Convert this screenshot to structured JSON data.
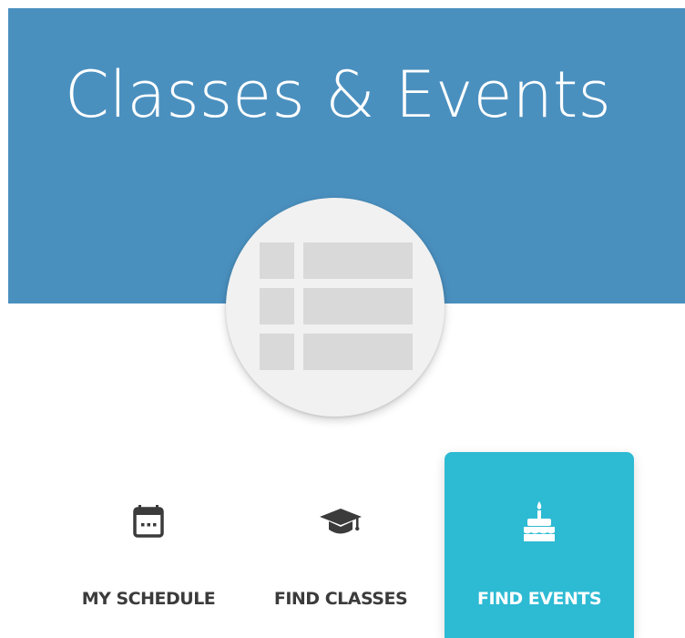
{
  "header": {
    "title": "Classes & Events",
    "background_color": "#4a90bf"
  },
  "avatar": {
    "icon": "table-list-placeholder-icon"
  },
  "nav": {
    "active_color": "#2dbad3",
    "items": [
      {
        "label": "MY SCHEDULE",
        "icon": "calendar-icon",
        "active": false
      },
      {
        "label": "FIND CLASSES",
        "icon": "graduation-cap-icon",
        "active": false
      },
      {
        "label": "FIND EVENTS",
        "icon": "birthday-cake-icon",
        "active": true
      }
    ]
  }
}
